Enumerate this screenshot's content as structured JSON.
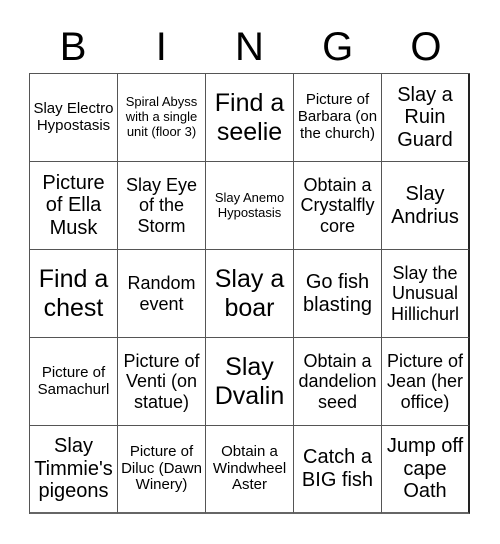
{
  "header": {
    "letters": [
      "B",
      "I",
      "N",
      "G",
      "O"
    ]
  },
  "board": {
    "cells": [
      {
        "text": "Slay Electro Hypostasis",
        "size": "sm"
      },
      {
        "text": "Spiral Abyss with a single unit (floor 3)",
        "size": "xs"
      },
      {
        "text": "Find a seelie",
        "size": "xl"
      },
      {
        "text": "Picture of Barbara (on the church)",
        "size": "sm"
      },
      {
        "text": "Slay a Ruin Guard",
        "size": "lg"
      },
      {
        "text": "Picture of Ella Musk",
        "size": "lg"
      },
      {
        "text": "Slay Eye of the Storm",
        "size": "md"
      },
      {
        "text": "Slay Anemo Hypostasis",
        "size": "xs"
      },
      {
        "text": "Obtain a Crystalfly core",
        "size": "md"
      },
      {
        "text": "Slay Andrius",
        "size": "lg"
      },
      {
        "text": "Find a chest",
        "size": "xl"
      },
      {
        "text": "Random event",
        "size": "md"
      },
      {
        "text": "Slay a boar",
        "size": "xl"
      },
      {
        "text": "Go fish blasting",
        "size": "lg"
      },
      {
        "text": "Slay the Unusual Hillichurl",
        "size": "md"
      },
      {
        "text": "Picture of Samachurl",
        "size": "sm"
      },
      {
        "text": "Picture of Venti (on statue)",
        "size": "md"
      },
      {
        "text": "Slay Dvalin",
        "size": "xl"
      },
      {
        "text": "Obtain a dandelion seed",
        "size": "md"
      },
      {
        "text": "Picture of Jean (her office)",
        "size": "md"
      },
      {
        "text": "Slay Timmie's pigeons",
        "size": "lg"
      },
      {
        "text": "Picture of Diluc (Dawn Winery)",
        "size": "sm"
      },
      {
        "text": "Obtain a Windwheel Aster",
        "size": "sm"
      },
      {
        "text": "Catch a BIG fish",
        "size": "lg"
      },
      {
        "text": "Jump off cape Oath",
        "size": "lg"
      }
    ]
  }
}
